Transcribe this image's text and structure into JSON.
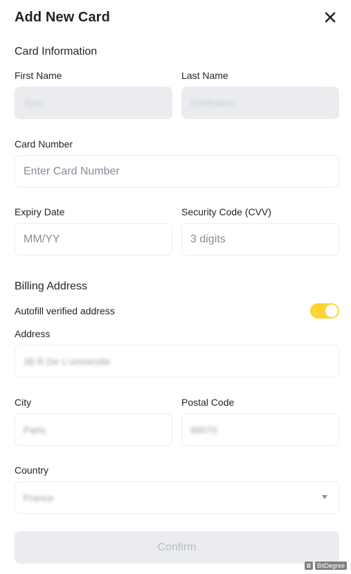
{
  "header": {
    "title": "Add New Card"
  },
  "card_info": {
    "section_title": "Card Information",
    "first_name": {
      "label": "First Name",
      "value": "Tom"
    },
    "last_name": {
      "label": "Last Name",
      "value": "Smithsten"
    },
    "card_number": {
      "label": "Card Number",
      "placeholder": "Enter Card Number"
    },
    "expiry": {
      "label": "Expiry Date",
      "placeholder": "MM/YY"
    },
    "cvv": {
      "label": "Security Code (CVV)",
      "placeholder": "3 digits"
    }
  },
  "billing": {
    "section_title": "Billing Address",
    "autofill_label": "Autofill verified address",
    "autofill_on": true,
    "address": {
      "label": "Address",
      "value": "38 R.De L'universite"
    },
    "city": {
      "label": "City",
      "value": "Paris"
    },
    "postal_code": {
      "label": "Postal Code",
      "value": "89070"
    },
    "country": {
      "label": "Country",
      "value": "France"
    }
  },
  "confirm_label": "Confirm",
  "watermark": {
    "logo": "B",
    "text": "BitDegree"
  },
  "colors": {
    "accent": "#fcd535",
    "field_border": "#eaecef",
    "disabled_bg": "#eaecef",
    "text": "#1e2329",
    "placeholder": "#848e9c"
  }
}
